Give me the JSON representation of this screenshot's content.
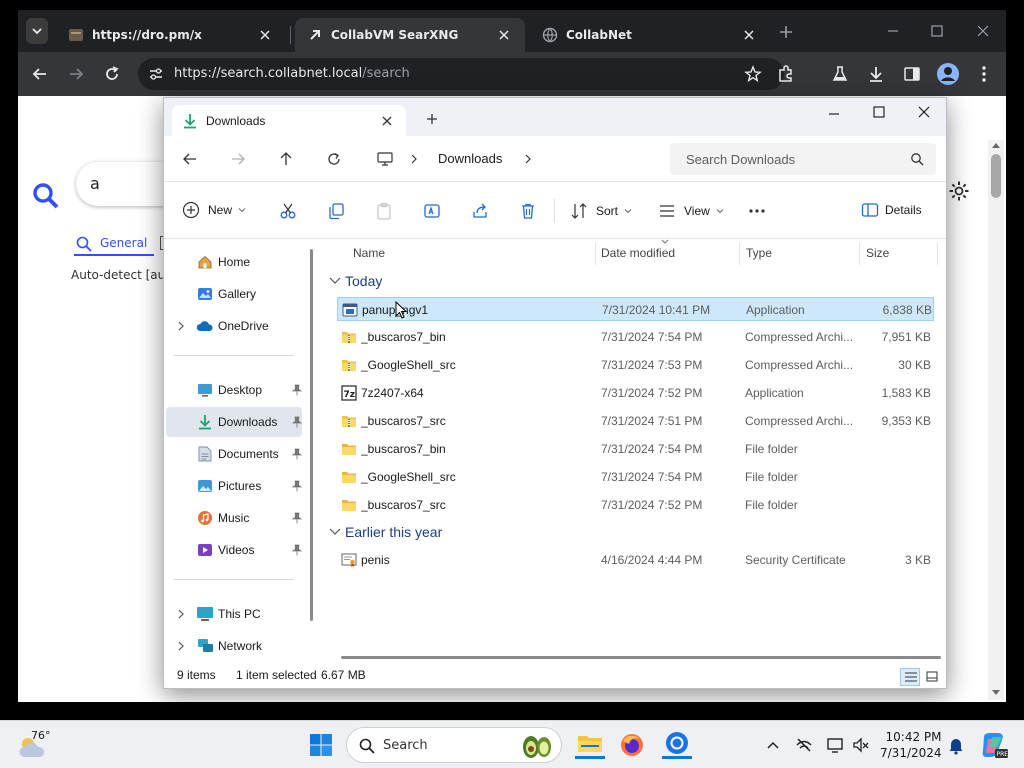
{
  "browser": {
    "tabs": [
      {
        "title": "https://dro.pm/x"
      },
      {
        "title": "CollabVM SearXNG"
      },
      {
        "title": "CollabNet"
      }
    ],
    "url_base": "https://search.collabnet.local",
    "url_path": "/search"
  },
  "searxng": {
    "query": "a",
    "tab_general": "General",
    "autodetect": "Auto-detect [aut"
  },
  "explorer": {
    "tab_title": "Downloads",
    "breadcrumb": "Downloads",
    "search_placeholder": "Search Downloads",
    "commands": {
      "new": "New",
      "sort": "Sort",
      "view": "View",
      "details": "Details"
    },
    "nav": [
      {
        "label": "Home",
        "icon": "home-icon"
      },
      {
        "label": "Gallery",
        "icon": "gallery-icon"
      },
      {
        "label": "OneDrive",
        "icon": "cloud-icon"
      },
      {
        "label": "Desktop",
        "icon": "desktop-icon"
      },
      {
        "label": "Downloads",
        "icon": "download-icon"
      },
      {
        "label": "Documents",
        "icon": "documents-icon"
      },
      {
        "label": "Pictures",
        "icon": "pictures-icon"
      },
      {
        "label": "Music",
        "icon": "music-icon"
      },
      {
        "label": "Videos",
        "icon": "videos-icon"
      },
      {
        "label": "This PC",
        "icon": "pc-icon"
      },
      {
        "label": "Network",
        "icon": "network-icon"
      }
    ],
    "columns": {
      "name": "Name",
      "date": "Date modified",
      "type": "Type",
      "size": "Size"
    },
    "groups": {
      "today": "Today",
      "earlier": "Earlier this year"
    },
    "files": [
      {
        "name": "panup_ngv1",
        "date": "7/31/2024 10:41 PM",
        "type": "Application",
        "size": "6,838 KB",
        "icon": "app-icon"
      },
      {
        "name": "_buscaros7_bin",
        "date": "7/31/2024 7:54 PM",
        "type": "Compressed Archi...",
        "size": "7,951 KB",
        "icon": "zip-icon"
      },
      {
        "name": "_GoogleShell_src",
        "date": "7/31/2024 7:53 PM",
        "type": "Compressed Archi...",
        "size": "30 KB",
        "icon": "zip-icon"
      },
      {
        "name": "7z2407-x64",
        "date": "7/31/2024 7:52 PM",
        "type": "Application",
        "size": "1,583 KB",
        "icon": "7zip-icon"
      },
      {
        "name": "_buscaros7_src",
        "date": "7/31/2024 7:51 PM",
        "type": "Compressed Archi...",
        "size": "9,353 KB",
        "icon": "zip-icon"
      },
      {
        "name": "_buscaros7_bin",
        "date": "7/31/2024 7:54 PM",
        "type": "File folder",
        "size": "",
        "icon": "folder-icon"
      },
      {
        "name": "_GoogleShell_src",
        "date": "7/31/2024 7:54 PM",
        "type": "File folder",
        "size": "",
        "icon": "folder-icon"
      },
      {
        "name": "_buscaros7_src",
        "date": "7/31/2024 7:52 PM",
        "type": "File folder",
        "size": "",
        "icon": "folder-icon"
      }
    ],
    "earlier_files": [
      {
        "name": "penis",
        "date": "4/16/2024 4:44 PM",
        "type": "Security Certificate",
        "size": "3 KB",
        "icon": "certificate-icon"
      }
    ],
    "status": {
      "count": "9 items",
      "selected": "1 item selected",
      "size": "6.67 MB"
    }
  },
  "taskbar": {
    "weather": "76°",
    "search_placeholder": "Search",
    "time": "10:42 PM",
    "date": "7/31/2024"
  },
  "colors": {
    "accent": "#3050ff",
    "selection": "#cde8fb",
    "chrome_dark": "#202124"
  }
}
